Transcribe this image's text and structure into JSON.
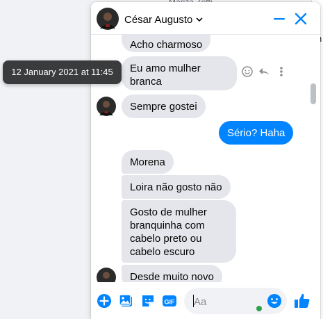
{
  "background": {
    "peek_name": "Mariza Zotti",
    "right_char": "h"
  },
  "chat": {
    "contact_name": "César Augusto",
    "tooltip": "12 January 2021 at 11:45",
    "messages": [
      {
        "id": "m1",
        "from": "them",
        "text": "Acho charmoso"
      },
      {
        "id": "m2",
        "from": "them",
        "text": "Eu amo mulher branca"
      },
      {
        "id": "m3",
        "from": "them",
        "text": "Sempre gostei"
      },
      {
        "id": "m4",
        "from": "me",
        "text": "Sério? Haha"
      },
      {
        "id": "m5",
        "from": "them",
        "text": "Morena"
      },
      {
        "id": "m6",
        "from": "them",
        "text": "Loira não gosto não"
      },
      {
        "id": "m7",
        "from": "them",
        "text": "Gosto de mulher branquinha com cabelo preto ou cabelo escuro"
      },
      {
        "id": "m8",
        "from": "them",
        "text": "Desde muito novo"
      }
    ],
    "composer": {
      "placeholder": "Aa",
      "gif_label": "GIF"
    }
  },
  "colors": {
    "accent": "#0084ff",
    "bubble_them": "#e4e6eb",
    "tooltip_bg": "#3a3b3c",
    "online": "#31a24c"
  },
  "icons": [
    "chevron-down-icon",
    "minimize-icon",
    "close-icon",
    "emoji-react-icon",
    "reply-icon",
    "more-icon",
    "plus-icon",
    "photo-icon",
    "sticker-icon",
    "gif-icon",
    "emoji-icon",
    "like-icon"
  ]
}
